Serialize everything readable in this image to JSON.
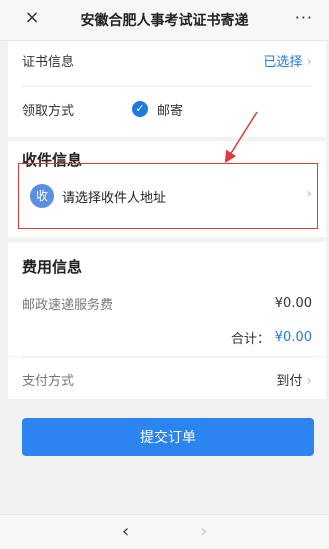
{
  "header": {
    "close_icon": "×",
    "title": "安徽合肥人事考试证书寄递",
    "more_icon": "···"
  },
  "certificate": {
    "label": "证书信息",
    "value": "已选择",
    "chevron": "›"
  },
  "delivery": {
    "label": "领取方式",
    "option_check": "✓",
    "option_label": "邮寄"
  },
  "recipient": {
    "title": "收件信息",
    "avatar_text": "收",
    "address_prompt": "请选择收件人地址",
    "chevron": "›"
  },
  "fees": {
    "title": "费用信息",
    "postal_label": "邮政速递服务费",
    "postal_amount": "¥0.00",
    "total_label": "合计：",
    "total_amount": "¥0.00"
  },
  "payment": {
    "label": "支付方式",
    "value": "到付",
    "chevron": "›"
  },
  "submit_label": "提交订单",
  "nav": {
    "back": "‹",
    "forward": "›"
  },
  "colors": {
    "accent": "#2b84f0",
    "annotation": "#e03b3b"
  }
}
